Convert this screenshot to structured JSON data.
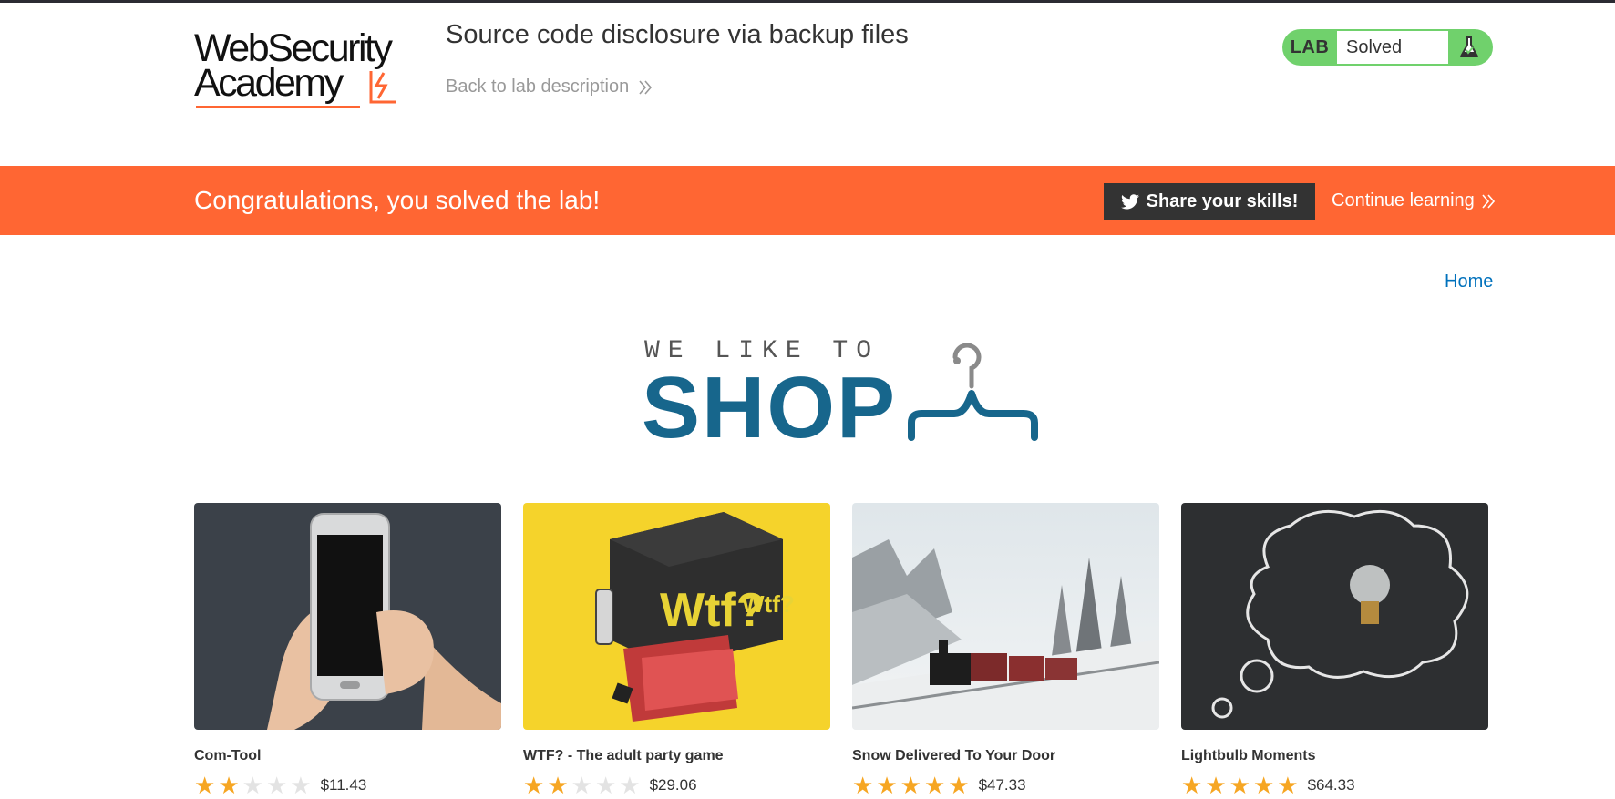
{
  "header": {
    "logo_line1": "WebSecurity",
    "logo_line2": "Academy",
    "lab_title": "Source code disclosure via backup files",
    "back_link": "Back to lab description"
  },
  "lab_status": {
    "label": "LAB",
    "status": "Solved",
    "icon": "flask-icon"
  },
  "banner": {
    "message": "Congratulations, you solved the lab!",
    "share_label": "Share your skills!",
    "continue_label": "Continue learning",
    "color": "#ff6633"
  },
  "nav": {
    "home": "Home"
  },
  "shop_logo": {
    "tagline": "WE LIKE TO",
    "word": "SHOP",
    "icon": "hanger-icon",
    "color": "#17668c"
  },
  "products": [
    {
      "name": "Com-Tool",
      "rating": 2,
      "max_rating": 5,
      "price": "$11.43",
      "image": "hand-holding-phone"
    },
    {
      "name": "WTF? - The adult party game",
      "rating": 2,
      "max_rating": 5,
      "price": "$29.06",
      "image": "party-game-box-on-yellow"
    },
    {
      "name": "Snow Delivered To Your Door",
      "rating": 5,
      "max_rating": 5,
      "price": "$47.33",
      "image": "steam-train-in-snow"
    },
    {
      "name": "Lightbulb Moments",
      "rating": 5,
      "max_rating": 5,
      "price": "$64.33",
      "image": "lightbulb-chalk-cloud"
    }
  ]
}
